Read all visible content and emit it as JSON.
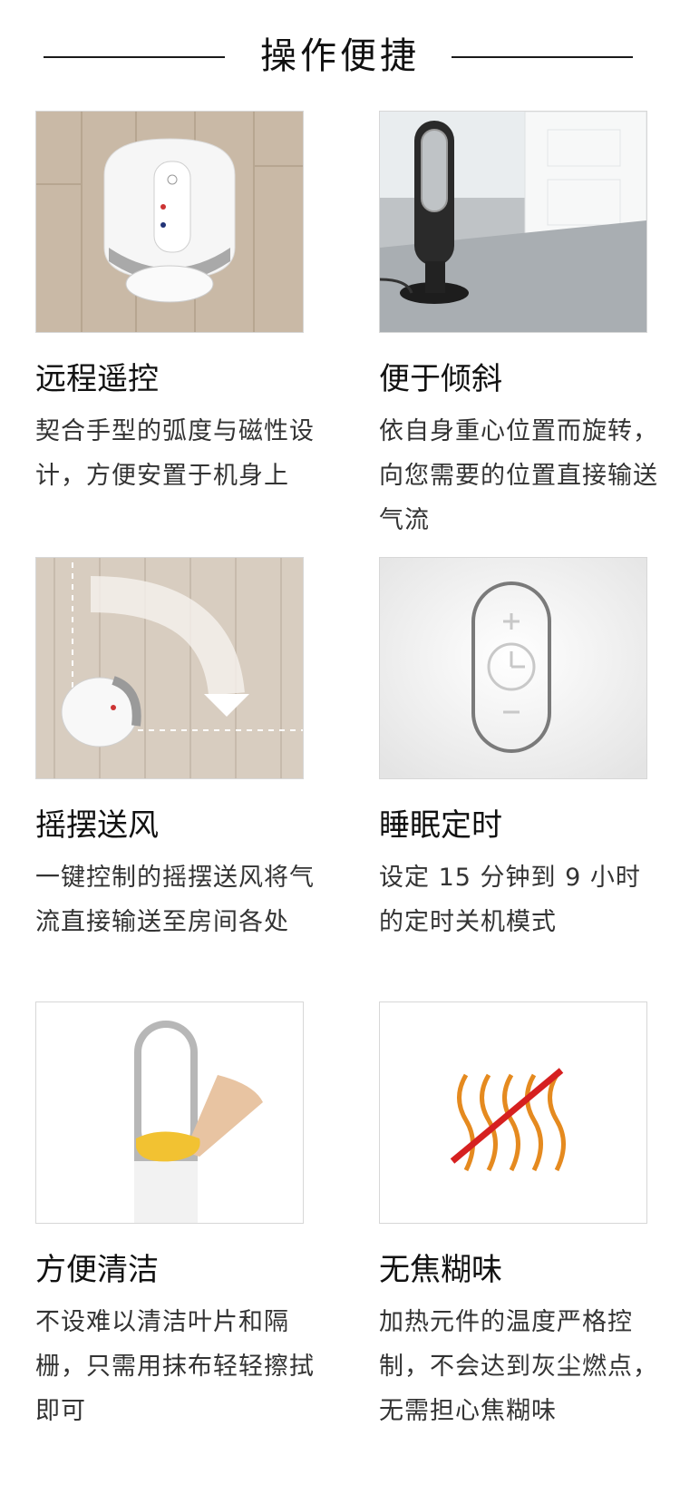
{
  "page": {
    "section_title": "操作便捷"
  },
  "features": [
    {
      "id": "remote",
      "image_icon": "remote-control-on-fan-icon",
      "title": "远程遥控",
      "description": "契合手型的弧度与磁性设计，方便安置于机身上"
    },
    {
      "id": "tilt",
      "image_icon": "tilted-fan-icon",
      "title": "便于倾斜",
      "description": "依自身重心位置而旋转，向您需要的位置直接输送气流"
    },
    {
      "id": "oscillation",
      "image_icon": "oscillation-arrow-icon",
      "title": "摇摆送风",
      "description": "一键控制的摇摆送风将气流直接输送至房间各处"
    },
    {
      "id": "sleep-timer",
      "image_icon": "sleep-timer-clock-icon",
      "title": "睡眠定时",
      "description": "设定 15 分钟到 9 小时的定时关机模式"
    },
    {
      "id": "cleaning",
      "image_icon": "wipe-cleaning-icon",
      "title": "方便清洁",
      "description": "不设难以清洁叶片和隔栅，只需用抹布轻轻擦拭即可"
    },
    {
      "id": "no-burnt-smell",
      "image_icon": "no-burnt-smell-icon",
      "title": "无焦糊味",
      "description": "加热元件的温度严格控制，不会达到灰尘燃点，无需担心焦糊味"
    }
  ]
}
